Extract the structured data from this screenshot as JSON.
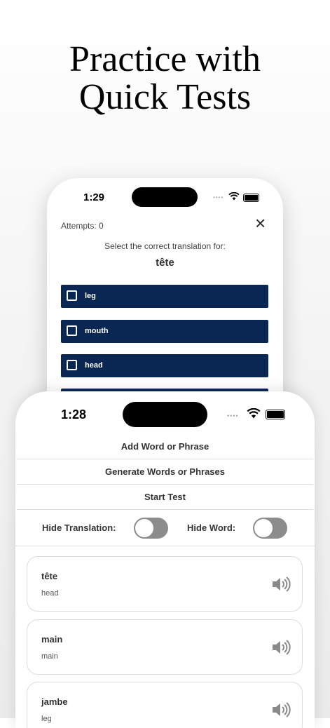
{
  "headline": {
    "line1": "Practice with",
    "line2": "Quick Tests"
  },
  "test_screen": {
    "status_time": "1:29",
    "attempts": "Attempts: 0",
    "close_icon": "×",
    "prompt": "Select the correct translation for:",
    "target_word": "tête",
    "options": [
      {
        "label": "leg"
      },
      {
        "label": "mouth"
      },
      {
        "label": "head"
      }
    ]
  },
  "list_screen": {
    "status_time": "1:28",
    "menu": {
      "add": "Add Word or Phrase",
      "generate": "Generate Words or Phrases",
      "start": "Start Test"
    },
    "toggles": {
      "hide_translation": "Hide Translation:",
      "hide_word": "Hide Word:"
    },
    "words": [
      {
        "word": "tête",
        "translation": "head"
      },
      {
        "word": "main",
        "translation": "main"
      },
      {
        "word": "jambe",
        "translation": "leg"
      }
    ]
  },
  "icons": {
    "wifi": "wifi-icon",
    "battery": "battery-icon",
    "speaker": "speaker-icon",
    "checkbox": "checkbox-icon",
    "close": "close-icon"
  },
  "colors": {
    "option_bg": "#0a2754",
    "switch_off": "#8c8c8c"
  }
}
